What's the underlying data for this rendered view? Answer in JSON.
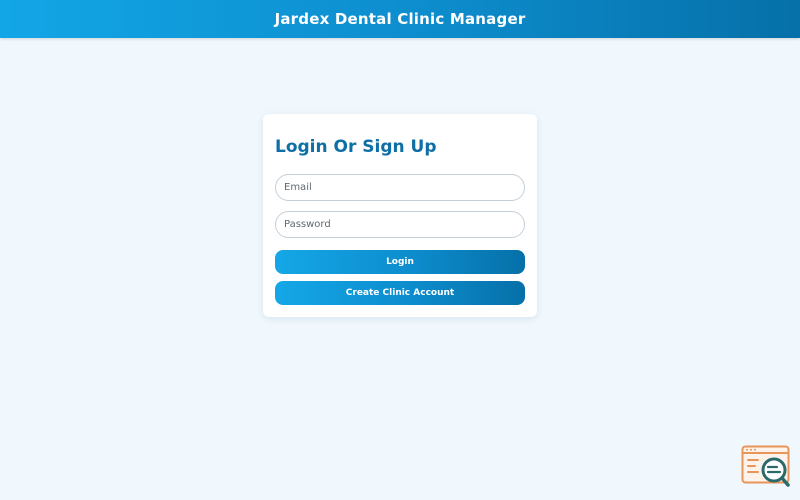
{
  "header": {
    "title": "Jardex Dental Clinic Manager"
  },
  "login_card": {
    "title": "Login Or Sign Up",
    "email_placeholder": "Email",
    "email_value": "",
    "password_placeholder": "Password",
    "password_value": "",
    "login_label": "Login",
    "create_account_label": "Create Clinic Account"
  },
  "widget": {
    "icon": "search-code-icon",
    "accent_color": "#e8955a",
    "lens_color": "#2b6a6a"
  },
  "colors": {
    "header_start": "#12a6e6",
    "header_end": "#0670a8",
    "title_color": "#0d6fa6",
    "background": "#f1f8fd"
  }
}
